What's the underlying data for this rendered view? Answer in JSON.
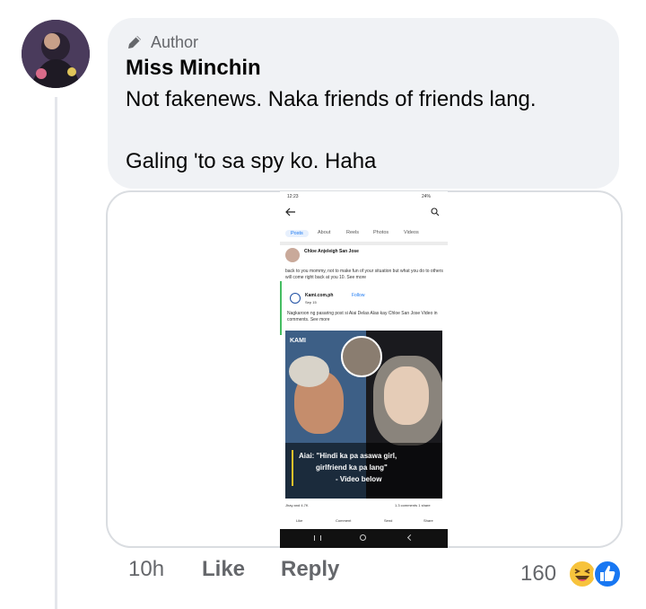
{
  "comment": {
    "author_badge": "Author",
    "name": "Miss Minchin",
    "line1": "Not fakenews. Naka friends of friends lang.",
    "line2": "Galing 'to sa spy ko. Haha",
    "time": "10h",
    "like_label": "Like",
    "reply_label": "Reply",
    "reaction_count": "160"
  },
  "screenshot": {
    "status_time": "12:23",
    "status_battery": "24%",
    "tabs": [
      "Posts",
      "About",
      "Reels",
      "Photos",
      "Videos"
    ],
    "poster_name": "Chloe Anjeleigh San Jose",
    "post_text": "back to you mommy, not to make fun of your situation but what you do to others will come right back at you 10. See more",
    "shared_page": "Kami.com.ph",
    "follow": "Follow",
    "shared_date": "Sep 15",
    "shared_text": "Nagkaroon ng pasaring post si Aiai Delas Alas kay Chloe San Jose Video in comments. See more",
    "brand": "KAMI",
    "caption_line1": "Aiai: \"Hindi ka pa asawa girl,",
    "caption_line2": "girlfriend ka pa lang\"",
    "caption_line3": "- Video below",
    "reactions": "Jhay and 4.7K",
    "comments_shares": "1.3 comments  1 share",
    "actions": [
      "Like",
      "Comment",
      "Send",
      "Share"
    ]
  },
  "colors": {
    "like_blue": "#1877f2",
    "bubble_bg": "#f0f2f5",
    "muted": "#65676b"
  },
  "icons": [
    "pen-icon",
    "back-arrow-icon",
    "search-icon",
    "haha-reaction-icon",
    "like-reaction-icon"
  ]
}
